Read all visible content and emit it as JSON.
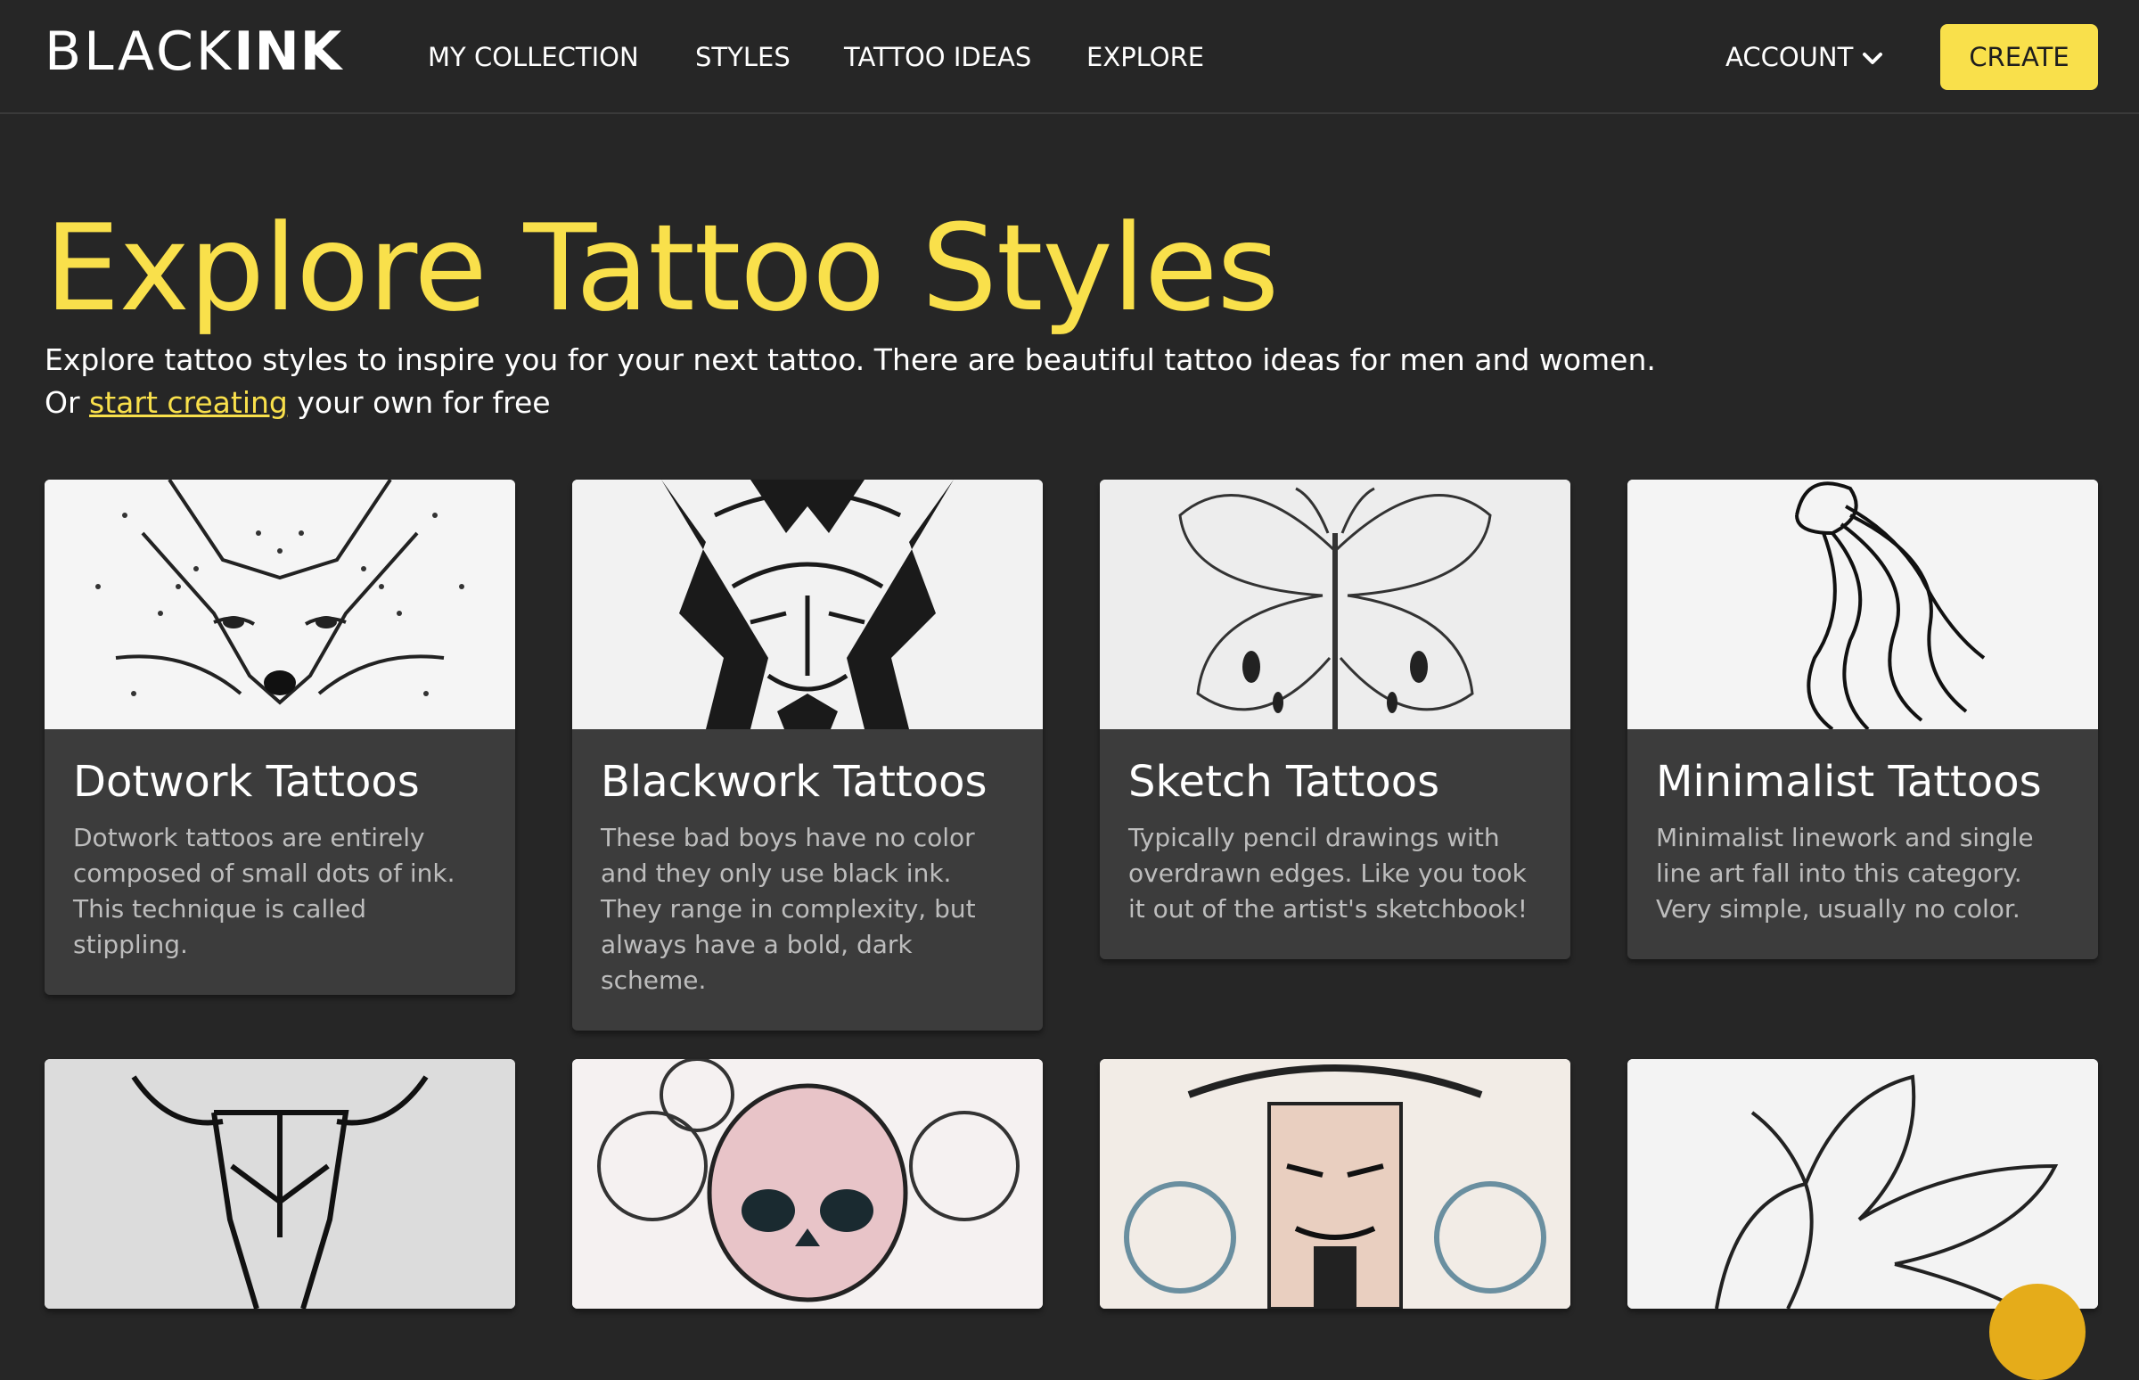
{
  "brand": {
    "thin": "BLACK",
    "bold": "INK"
  },
  "nav": {
    "links": [
      "MY COLLECTION",
      "STYLES",
      "TATTOO IDEAS",
      "EXPLORE"
    ],
    "account": "ACCOUNT",
    "create": "CREATE"
  },
  "hero": {
    "title": "Explore Tattoo Styles",
    "line1": "Explore tattoo styles to inspire you for your next tattoo. There are beautiful tattoo ideas for men and women.",
    "or": "Or",
    "link": "start creating",
    "rest": "your own for free"
  },
  "cards": [
    {
      "title": "Dotwork Tattoos",
      "desc": "Dotwork tattoos are entirely composed of small dots of ink. This technique is called stippling.",
      "icon": "fox-illustration"
    },
    {
      "title": "Blackwork Tattoos",
      "desc": "These bad boys have no color and they only use black ink. They range in complexity, but always have a bold, dark scheme.",
      "icon": "lion-illustration"
    },
    {
      "title": "Sketch Tattoos",
      "desc": "Typically pencil drawings with overdrawn edges. Like you took it out of the artist's sketchbook!",
      "icon": "butterfly-illustration"
    },
    {
      "title": "Minimalist Tattoos",
      "desc": "Minimalist linework and single line art fall into this category. Very simple, usually no color.",
      "icon": "jellyfish-illustration"
    },
    {
      "icon": "bull-skull-illustration"
    },
    {
      "icon": "skull-roses-illustration"
    },
    {
      "icon": "samurai-illustration"
    },
    {
      "icon": "flower-illustration"
    }
  ],
  "colors": {
    "background": "#262626",
    "accent": "#f9e04b",
    "card": "#3c3c3c",
    "chat": "#e5ac1a"
  }
}
